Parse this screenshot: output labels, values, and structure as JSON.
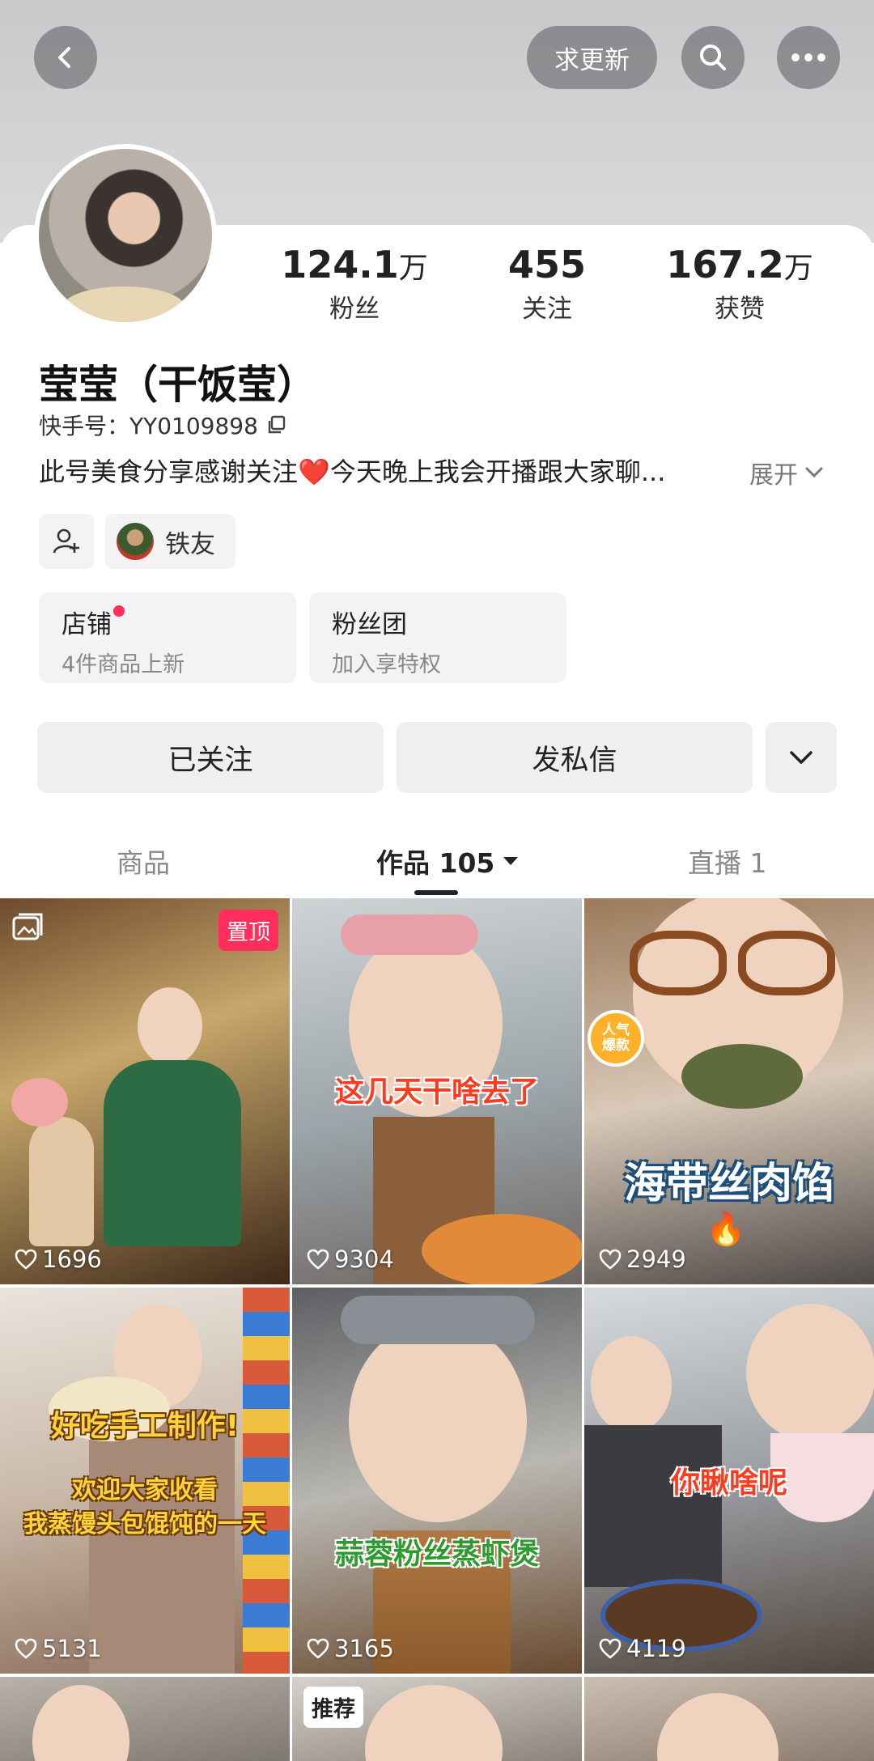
{
  "header": {
    "update_label": "求更新"
  },
  "stats": [
    {
      "value": "124.1",
      "unit": "万",
      "label": "粉丝"
    },
    {
      "value": "455",
      "unit": "",
      "label": "关注"
    },
    {
      "value": "167.2",
      "unit": "万",
      "label": "获赞"
    }
  ],
  "profile": {
    "name": "莹莹（干饭莹）",
    "uid": "快手号：YY0109898",
    "bio": "此号美食分享感谢关注❤️今天晚上我会开播跟大家聊...",
    "expand_label": "展开"
  },
  "chips": {
    "friend_label": "铁友"
  },
  "cards": [
    {
      "title": "店铺",
      "subtitle": "4件商品上新"
    },
    {
      "title": "粉丝团",
      "subtitle": "加入享特权"
    }
  ],
  "actions": {
    "followed_label": "已关注",
    "message_label": "发私信"
  },
  "tabs": [
    {
      "label": "商品"
    },
    {
      "label": "作品 105"
    },
    {
      "label": "直播 1"
    }
  ],
  "videos": [
    {
      "likes": "1696",
      "badge": "置顶",
      "caption": ""
    },
    {
      "likes": "9304",
      "badge": "",
      "caption": "这几天干啥去了"
    },
    {
      "likes": "2949",
      "badge": "人气爆款",
      "caption": "海带丝肉馅"
    },
    {
      "likes": "5131",
      "badge": "",
      "caption": "好吃手工制作!",
      "caption2": "欢迎大家收看",
      "caption3": "我蒸馒头包馄饨的一天"
    },
    {
      "likes": "3165",
      "badge": "",
      "caption": "蒜蓉粉丝蒸虾煲"
    },
    {
      "likes": "4119",
      "badge": "",
      "caption": "你瞅啥呢"
    },
    {
      "likes": "",
      "badge": "",
      "caption": ""
    },
    {
      "likes": "",
      "badge": "推荐",
      "caption": ""
    },
    {
      "likes": "",
      "badge": "",
      "caption": ""
    }
  ]
}
